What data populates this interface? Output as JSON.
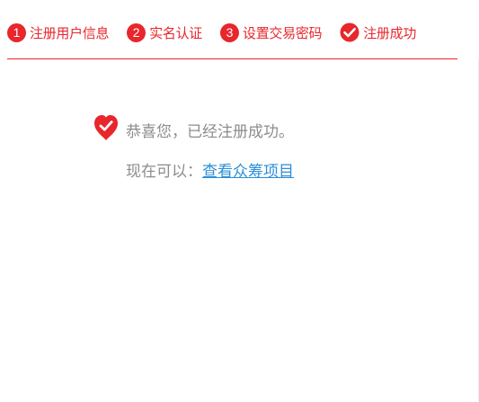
{
  "steps": [
    {
      "marker": "1",
      "label": "注册用户信息",
      "icon": "number-badge"
    },
    {
      "marker": "2",
      "label": "实名认证",
      "icon": "number-badge"
    },
    {
      "marker": "3",
      "label": "设置交易密码",
      "icon": "number-badge"
    },
    {
      "marker": "",
      "label": "注册成功",
      "icon": "check-badge"
    }
  ],
  "success": {
    "icon": "heart-check-icon",
    "message": "恭喜您，已经注册成功。",
    "next_prefix": "现在可以：",
    "next_link": "查看众筹项目"
  },
  "colors": {
    "accent": "#e8262c",
    "text_muted": "#8c8c8c",
    "link": "#2b8fd6"
  }
}
